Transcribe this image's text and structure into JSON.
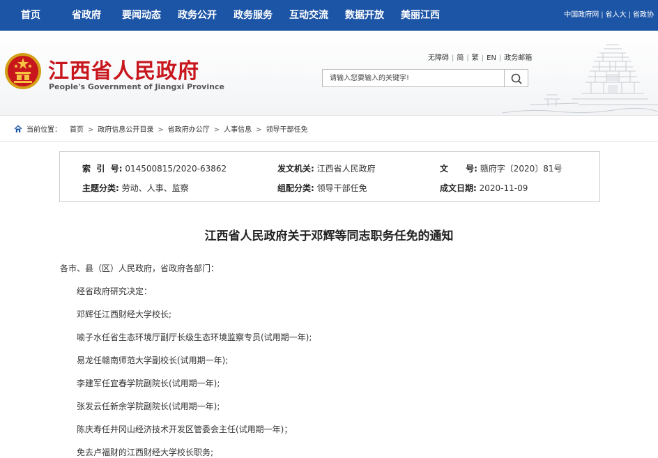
{
  "topnav": {
    "items": [
      "首页",
      "省政府",
      "要闻动态",
      "政务公开",
      "政务服务",
      "互动交流",
      "数据开放",
      "美丽江西"
    ],
    "right_links": [
      "中国政府网",
      "省人大",
      "省政协"
    ]
  },
  "header": {
    "title": "江西省人民政府",
    "subtitle": "People's Government of Jiangxi Province",
    "util_links": [
      "无障碍",
      "简",
      "繁",
      "EN",
      "政务邮箱"
    ],
    "search_placeholder": "请输入您要输入的关键字!",
    "brand_color": "#c8161d",
    "nav_color": "#1d55a6"
  },
  "breadcrumb": {
    "label": "当前位置：",
    "items": [
      "首页",
      "政府信息公开目录",
      "省政府办公厅",
      "人事信息",
      "领导干部任免"
    ]
  },
  "meta": {
    "index_label": "索  引  号:",
    "index_value": "014500815/2020-63862",
    "issuer_label": "发文机关:",
    "issuer_value": "江西省人民政府",
    "docno_label": "文      号:",
    "docno_value": "赣府字〔2020〕81号",
    "topic_label": "主题分类:",
    "topic_value": "劳动、人事、监察",
    "genre_label": "组配分类:",
    "genre_value": "领导干部任免",
    "date_label": "成文日期:",
    "date_value": "2020-11-09"
  },
  "document": {
    "title": "江西省人民政府关于邓辉等同志职务任免的通知",
    "salutation": "各市、县（区）人民政府，省政府各部门：",
    "paragraphs": [
      "经省政府研究决定：",
      "邓辉任江西财经大学校长;",
      "喻子水任省生态环境厅副厅长级生态环境监察专员(试用期一年);",
      "易龙任赣南师范大学副校长(试用期一年);",
      "李建军任宜春学院副院长(试用期一年);",
      "张发云任新余学院副院长(试用期一年);",
      "陈庆寿任井冈山经济技术开发区管委会主任(试用期一年)；",
      "免去卢福财的江西财经大学校长职务;"
    ]
  }
}
